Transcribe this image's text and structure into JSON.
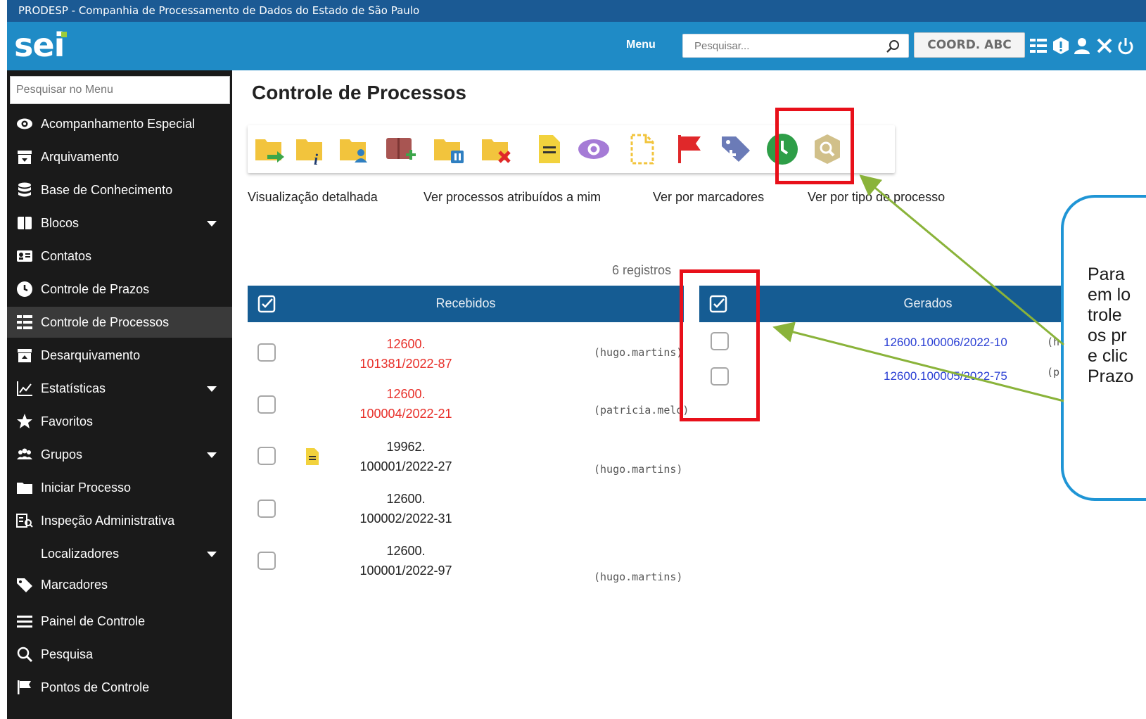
{
  "org_bar": {
    "text": "PRODESP - Companhia de Processamento de Dados do Estado de São Paulo"
  },
  "header": {
    "logo": "sei",
    "menu_label": "Menu",
    "search_placeholder": "Pesquisar...",
    "unit": "COORD. ABC",
    "icons": [
      "list-icon",
      "alert-icon",
      "user-icon",
      "tools-icon",
      "power-icon"
    ]
  },
  "sidebar": {
    "search_placeholder": "Pesquisar no Menu",
    "items": [
      {
        "label": "Acompanhamento Especial",
        "icon": "eye-icon"
      },
      {
        "label": "Arquivamento",
        "icon": "archive-icon"
      },
      {
        "label": "Base de Conhecimento",
        "icon": "database-icon"
      },
      {
        "label": "Blocos",
        "icon": "book-icon"
      },
      {
        "label": "Contatos",
        "icon": "contact-card-icon"
      },
      {
        "label": "Controle de Prazos",
        "icon": "clock-icon"
      },
      {
        "label": "Controle de Processos",
        "icon": "list-icon"
      },
      {
        "label": "Desarquivamento",
        "icon": "unarchive-icon"
      },
      {
        "label": "Estatísticas",
        "icon": "chart-icon"
      },
      {
        "label": "Favoritos",
        "icon": "star-icon"
      },
      {
        "label": "Grupos",
        "icon": "group-icon"
      },
      {
        "label": "Iniciar Processo",
        "icon": "folder-icon"
      },
      {
        "label": "Inspeção Administrativa",
        "icon": "inspect-icon"
      },
      {
        "label": "Localizadores",
        "icon": ""
      },
      {
        "label": "Marcadores",
        "icon": "tag-icon"
      },
      {
        "label": "Painel de Controle",
        "icon": "menu-icon"
      },
      {
        "label": "Pesquisa",
        "icon": "search-icon"
      },
      {
        "label": "Pontos de Controle",
        "icon": "flag-icon"
      }
    ]
  },
  "main": {
    "title": "Controle de Processos",
    "toolbar_icons": [
      "send-folder-icon",
      "folder-info-icon",
      "folder-assign-icon",
      "add-to-block-icon",
      "folder-pause-icon",
      "folder-close-icon",
      "annotation-icon",
      "follow-eye-icon",
      "new-document-icon",
      "marker-flag-icon",
      "add-tag-icon",
      "deadline-clock-icon",
      "inspection-shield-icon"
    ],
    "views": {
      "detailed": "Visualização detalhada",
      "assigned": "Ver processos atribuídos a mim",
      "markers": "Ver por marcadores",
      "by_type": "Ver por tipo de processo"
    },
    "records_count": "6 registros",
    "received": {
      "header": "Recebidos",
      "rows": [
        {
          "line1": "12600.",
          "line2": "101381/2022-87",
          "user": "(hugo.martins)",
          "color": "#e8302a",
          "has_note": false
        },
        {
          "line1": "12600.",
          "line2": "100004/2022-21",
          "user": "(patricia.melo)",
          "color": "#e8302a",
          "has_note": false
        },
        {
          "line1": "19962.",
          "line2": "100001/2022-27",
          "user": "(hugo.martins)",
          "color": "#222222",
          "has_note": true
        },
        {
          "line1": "12600.",
          "line2": "100002/2022-31",
          "user": "",
          "color": "#222222",
          "has_note": false
        },
        {
          "line1": "12600.",
          "line2": "100001/2022-97",
          "user": "(hugo.martins)",
          "color": "#222222",
          "has_note": false
        }
      ]
    },
    "generated": {
      "header": "Gerados",
      "rows": [
        {
          "number": "12600.100006/2022-10",
          "user_fragment": "(h"
        },
        {
          "number": "12600.100005/2022-75",
          "user_fragment": "(p"
        }
      ]
    }
  },
  "callout": {
    "lines": [
      "Para",
      "em lo",
      "trole",
      "os pr",
      "e clic",
      "Prazo"
    ]
  },
  "colors": {
    "header_blue": "#1f8bc6",
    "org_bar_blue": "#1b5a94",
    "table_header_blue": "#155c93",
    "sidebar_bg": "#1a1a1a",
    "highlight_red": "#e8101a",
    "arrow_green": "#8ab33a",
    "callout_border": "#1f95d5"
  }
}
